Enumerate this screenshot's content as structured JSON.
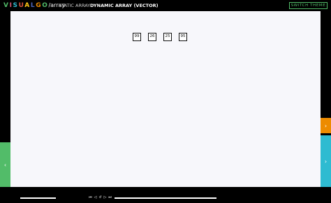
{
  "header": {
    "logo_letters": [
      "V",
      "I",
      "S",
      "U",
      "A",
      "L",
      "G",
      "O"
    ],
    "logo_colors": [
      "#52bc69",
      "#d65775",
      "#2ebbd1",
      "#d9513c",
      "#fec515",
      "#4b65ba",
      "#ed8b00",
      "#52bc69"
    ],
    "logo_suffix": "/array",
    "modes": [
      {
        "label": "STATIC ARRAY",
        "active": false
      },
      {
        "label": "DYNAMIC ARRAY (VECTOR)",
        "active": true
      }
    ],
    "switch_theme_label": "SWITCH THEME"
  },
  "array": {
    "values": [
      "99",
      "26",
      "25",
      "95"
    ]
  },
  "side_controls": {
    "left_arrow": "‹",
    "right_top_arrow": "›",
    "right_bottom_arrow": "›"
  },
  "playback": {
    "buttons": [
      {
        "name": "go-to-beginning-icon",
        "glyph": "⏮"
      },
      {
        "name": "step-backward-icon",
        "glyph": "◁"
      },
      {
        "name": "replay-icon",
        "glyph": "↺"
      },
      {
        "name": "step-forward-icon",
        "glyph": "▷"
      },
      {
        "name": "go-to-end-icon",
        "glyph": "⏭"
      }
    ]
  },
  "colors": {
    "accent_green": "#52bc69",
    "accent_orange": "#ed8b00",
    "accent_cyan": "#2ebbd1",
    "canvas_bg": "#f7f7fb"
  }
}
